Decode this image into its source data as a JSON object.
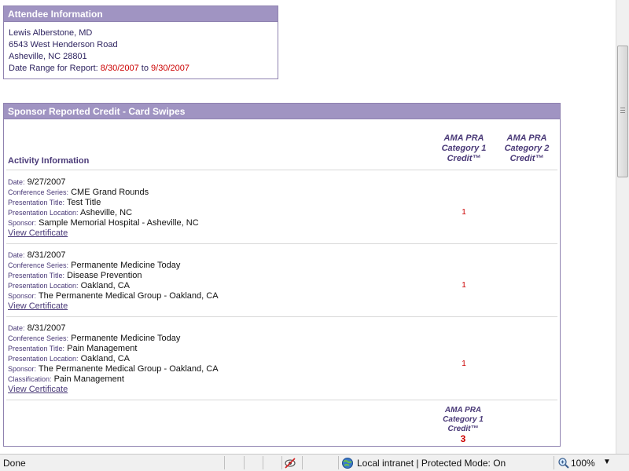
{
  "attendee": {
    "title": "Attendee Information",
    "name": "Lewis Alberstone, MD",
    "street": "6543 West Henderson Road",
    "city": "Asheville, NC 28801",
    "range_label": "Date Range for Report: ",
    "range_start": "8/30/2007",
    "range_to": " to ",
    "range_end": "9/30/2007"
  },
  "sponsor": {
    "title": "Sponsor Reported Credit - Card Swipes",
    "activity_header": "Activity Information",
    "col1_header": [
      "AMA PRA",
      "Category 1",
      "Credit™"
    ],
    "col2_header": [
      "AMA PRA",
      "Category 2",
      "Credit™"
    ],
    "labels": {
      "date": "Date:",
      "series": "Conference Series:",
      "title": "Presentation Title:",
      "location": "Presentation Location:",
      "sponsor": "Sponsor:",
      "classification": "Classification:"
    },
    "view_certificate": "View Certificate",
    "activities": [
      {
        "date": "9/27/2007",
        "series": "CME Grand Rounds",
        "title": "Test Title",
        "location": "Asheville, NC",
        "sponsor": "Sample Memorial Hospital - Asheville, NC",
        "credit": "1"
      },
      {
        "date": "8/31/2007",
        "series": "Permanente Medicine Today",
        "title": "Disease Prevention",
        "location": "Oakland, CA",
        "sponsor": "The Permanente Medical Group - Oakland, CA",
        "credit": "1"
      },
      {
        "date": "8/31/2007",
        "series": "Permanente Medicine Today",
        "title": "Pain Management",
        "location": "Oakland, CA",
        "sponsor": "The Permanente Medical Group - Oakland, CA",
        "classification": "Pain Management",
        "credit": "1"
      }
    ],
    "total_header": [
      "AMA PRA",
      "Category 1",
      "Credit™"
    ],
    "total_value": "3"
  },
  "statusbar": {
    "done": "Done",
    "zone": "Local intranet | Protected Mode: On",
    "zoom": "100%",
    "zoom_arrow": "▼"
  },
  "colors": {
    "header_bg": "#a094c2",
    "border": "#8f82b0",
    "accent_text": "#4a3a78",
    "credit_red": "#cc0000"
  },
  "icons": [
    "privacy-eye-icon",
    "globe-icon",
    "zoom-magnifier-icon",
    "zoom-dropdown-icon"
  ]
}
